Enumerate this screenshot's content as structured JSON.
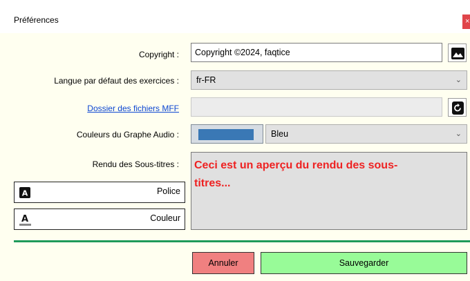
{
  "window": {
    "title": "Préférences",
    "close_label": "×"
  },
  "copyright": {
    "label": "Copyright :",
    "value": "Copyright ©2024, faqtice",
    "button_icon": "image-icon"
  },
  "language": {
    "label": "Langue par défaut des exercices :",
    "value": "fr-FR"
  },
  "mff_folder": {
    "link_label": "Dossier des fichiers MFF",
    "value": "",
    "button_icon": "refresh-icon"
  },
  "audio_graph": {
    "label": "Couleurs du Graphe Audio :",
    "swatch_color": "#3a78b5",
    "value": "Bleu"
  },
  "subtitles": {
    "label": "Rendu des Sous-titres :",
    "preview_line1": "Ceci est un aperçu du rendu des sous-",
    "preview_line2": "titres...",
    "preview_color": "#ee2222",
    "font_button": "Police",
    "color_button": "Couleur"
  },
  "actions": {
    "cancel_label": "Annuler",
    "save_label": "Sauvegarder",
    "cancel_color": "#f08080",
    "save_color": "#98fb98"
  }
}
